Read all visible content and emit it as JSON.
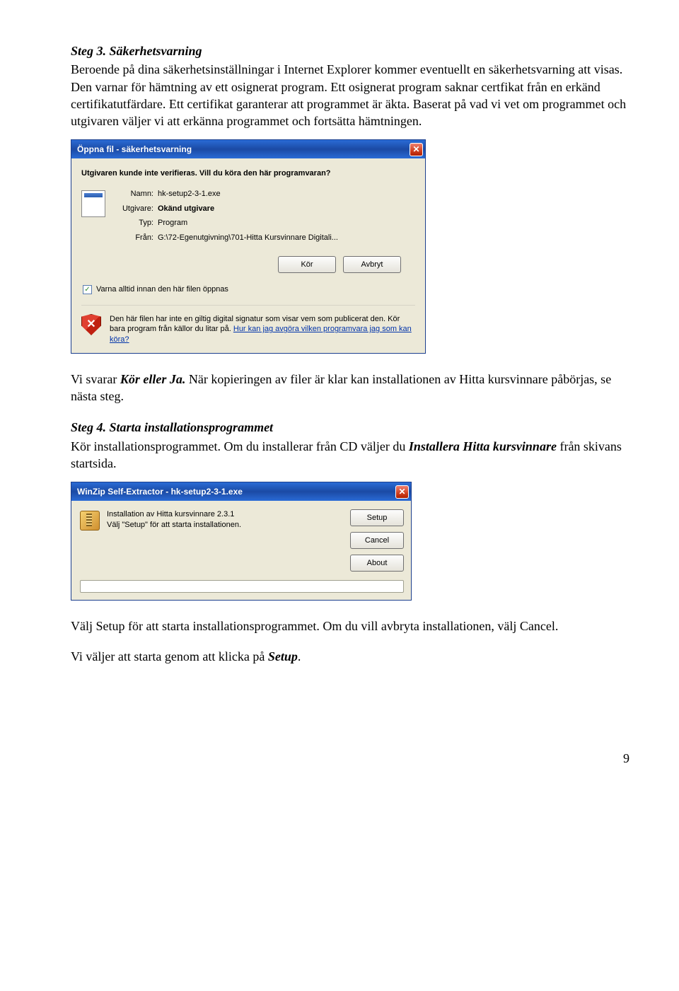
{
  "step3": {
    "heading": "Steg 3. Säkerhetsvarning",
    "para1": "Beroende på dina säkerhetsinställningar i Internet Explorer kommer eventuellt en säkerhetsvarning att visas. Den varnar för hämtning av ett osignerat program. Ett osignerat program saknar certfikat från en erkänd certifikatutfärdare. Ett certifikat garanterar att programmet är äkta. Baserat på vad vi vet om programmet och utgivaren väljer vi att erkänna programmet och fortsätta hämtningen."
  },
  "dialog1": {
    "title": "Öppna fil - säkerhetsvarning",
    "close_label": "✕",
    "question": "Utgivaren kunde inte verifieras. Vill du köra den här programvaran?",
    "labels": {
      "name": "Namn:",
      "publisher": "Utgivare:",
      "type": "Typ:",
      "from": "Från:"
    },
    "values": {
      "name": "hk-setup2-3-1.exe",
      "publisher": "Okänd utgivare",
      "type": "Program",
      "from": "G:\\72-Egenutgivning\\701-Hitta Kursvinnare Digitali..."
    },
    "btn_run": "Kör",
    "btn_cancel": "Avbryt",
    "checkbox_label": "Varna alltid innan den här filen öppnas",
    "checkbox_checked": "✓",
    "warn_text_a": "Den här filen har inte en giltig digital signatur som visar vem som publicerat den. Kör bara program från källor du litar på. ",
    "warn_link": "Hur kan jag avgöra vilken programvara jag som kan köra?"
  },
  "after_dialog1": {
    "para": "Vi svarar Kör eller Ja. När kopieringen av filer är klar kan installationen av Hitta kursvinnare påbörjas, se nästa steg.",
    "bold_words": "Kör eller Ja."
  },
  "step4": {
    "heading": "Steg 4. Starta installationsprogrammet",
    "para": "Kör installationsprogrammet. Om du installerar från CD väljer du Installera Hitta kursvinnare från skivans startsida.",
    "bold_words": "Installera Hitta kursvinnare"
  },
  "dialog2": {
    "title": "WinZip Self-Extractor - hk-setup2-3-1.exe",
    "close_label": "✕",
    "text_line1": "Installation av Hitta kursvinnare 2.3.1",
    "text_line2": "Välj \"Setup\" för att starta installationen.",
    "btn_setup": "Setup",
    "btn_cancel": "Cancel",
    "btn_about": "About"
  },
  "after_dialog2": {
    "para1": "Välj Setup för att starta installationsprogrammet. Om du vill avbryta installationen, välj Cancel.",
    "para2_a": "Vi väljer att starta genom att klicka på ",
    "para2_b": "Setup",
    "para2_c": "."
  },
  "page_number": "9"
}
